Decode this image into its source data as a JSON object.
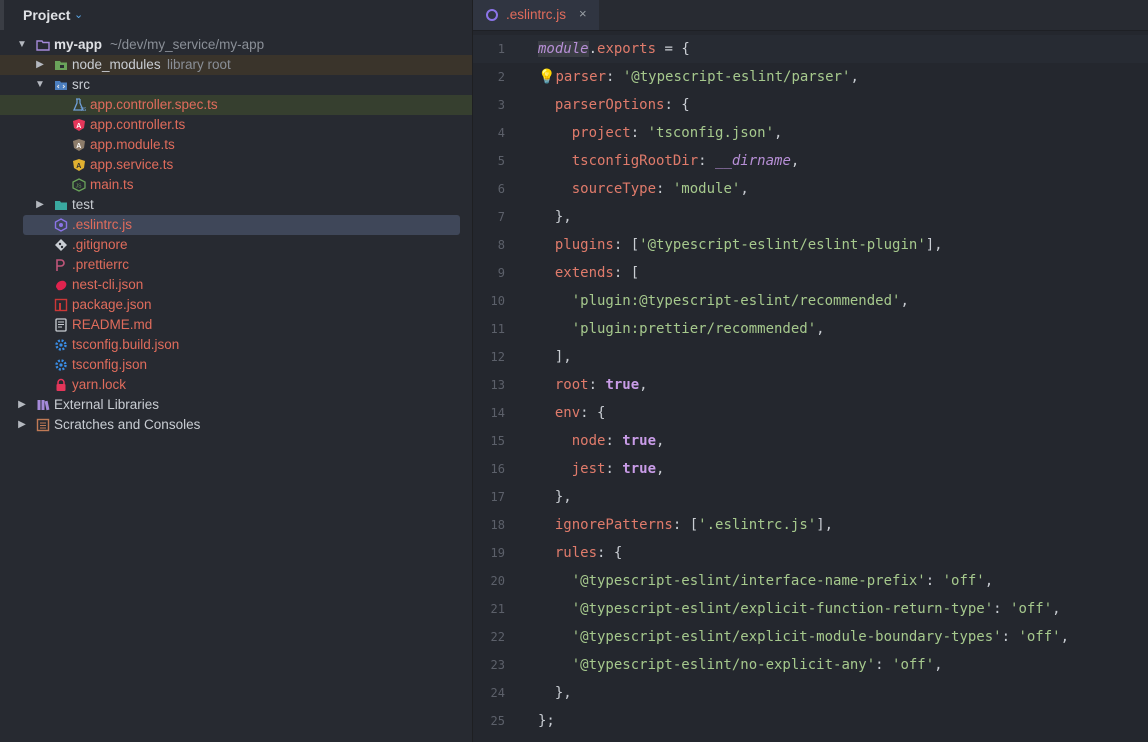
{
  "sidebar": {
    "title": "Project",
    "tree": [
      {
        "label": "my-app",
        "hint": "~/dev/my_service/my-app",
        "icon": "folder-icon"
      },
      {
        "label": "node_modules",
        "hint": "library root",
        "icon": "node-modules-folder-icon"
      },
      {
        "label": "src",
        "icon": "source-folder-icon"
      },
      {
        "label": "app.controller.spec.ts",
        "icon": "test-file-icon"
      },
      {
        "label": "app.controller.ts",
        "icon": "angular-icon"
      },
      {
        "label": "app.module.ts",
        "icon": "angular-icon"
      },
      {
        "label": "app.service.ts",
        "icon": "angular-icon"
      },
      {
        "label": "main.ts",
        "icon": "js-icon"
      },
      {
        "label": "test",
        "icon": "test-folder-icon"
      },
      {
        "label": ".eslintrc.js",
        "icon": "eslint-icon"
      },
      {
        "label": ".gitignore",
        "icon": "git-icon"
      },
      {
        "label": ".prettierrc",
        "icon": "prettier-icon"
      },
      {
        "label": "nest-cli.json",
        "icon": "nest-icon"
      },
      {
        "label": "package.json",
        "icon": "npm-icon"
      },
      {
        "label": "README.md",
        "icon": "markdown-icon"
      },
      {
        "label": "tsconfig.build.json",
        "icon": "tsconfig-icon"
      },
      {
        "label": "tsconfig.json",
        "icon": "tsconfig-icon"
      },
      {
        "label": "yarn.lock",
        "icon": "lock-icon"
      },
      {
        "label": "External Libraries",
        "icon": "library-icon"
      },
      {
        "label": "Scratches and Consoles",
        "icon": "scratches-icon"
      }
    ]
  },
  "editor": {
    "tab_label": ".eslintrc.js",
    "tab_close": "×",
    "line_numbers": [
      "1",
      "2",
      "3",
      "4",
      "5",
      "6",
      "7",
      "8",
      "9",
      "10",
      "11",
      "12",
      "13",
      "14",
      "15",
      "16",
      "17",
      "18",
      "19",
      "20",
      "21",
      "22",
      "23",
      "24",
      "25"
    ]
  },
  "colors": {
    "accent": "#3f4759",
    "vcs_modified": "#e06c5c",
    "string": "#a6c98d",
    "keyword": "#c99ce8"
  }
}
